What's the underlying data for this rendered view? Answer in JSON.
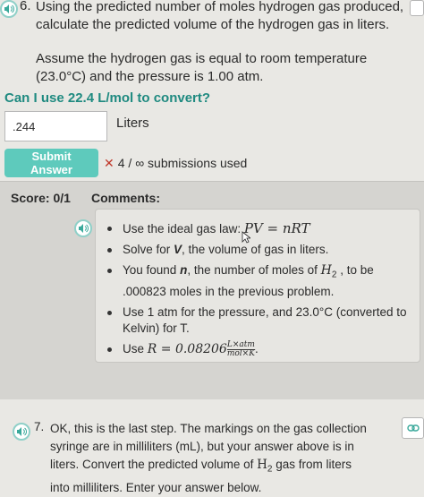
{
  "question6": {
    "number": "6.",
    "text": "Using the predicted number of moles hydrogen gas produced, calculate the predicted volume of the hydrogen gas in liters.",
    "assumption": "Assume the hydrogen gas is equal to room temperature (23.0°C) and the pressure is 1.00 atm."
  },
  "hint_question": "Can I use 22.4 L/mol to convert?",
  "answer": {
    "value": ".244",
    "unit": "Liters"
  },
  "submit_label": "Submit Answer",
  "submissions": {
    "mark": "✕",
    "text": "4 / ∞ submissions used"
  },
  "feedback": {
    "score_label": "Score: 0/1",
    "comments_title": "Comments:",
    "comments": {
      "c1_text": "Use the ideal gas law: ",
      "c1_eq": "PV = nRT",
      "c2_a": "Solve for ",
      "c2_b": "V",
      "c2_c": ", the volume of gas in liters.",
      "c3_a": "You found ",
      "c3_b": "n",
      "c3_c": ", the number of moles of ",
      "c3_d": "H",
      "c3_e": "2",
      "c3_f": " , to be .000823 moles in the previous problem.",
      "c4": "Use 1 atm for the pressure, and 23.0°C (converted to Kelvin) for T.",
      "c5_a": "Use ",
      "c5_eq": "R = 0.08206",
      "c5_num": "L×atm",
      "c5_den": "mol×K",
      "c5_end": "."
    }
  },
  "question7": {
    "number": "7.",
    "text_a": "OK, this is the last step. The markings on the gas collection syringe are in milliliters (mL), but your answer above is in liters. Convert the predicted volume of ",
    "text_h": "H",
    "text_sub": "2",
    "text_b": " gas from liters into milliliters. Enter your answer below."
  },
  "colors": {
    "accent": "#5ecabc",
    "hint": "#1f8a80",
    "error": "#c0392b"
  }
}
